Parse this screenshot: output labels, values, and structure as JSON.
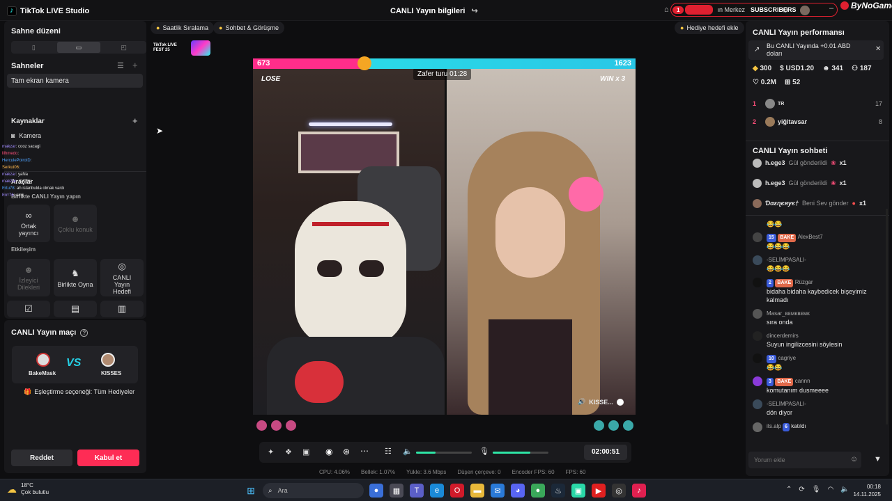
{
  "titlebar": {
    "app_name": "TikTok LIVE Studio",
    "center_title": "CANLI Yayın bilgileri",
    "promo_text": "ın Merkez",
    "subscribers_label": "SUBSCRIBERS",
    "notification_count": "1",
    "brand": "ByNoGame"
  },
  "left": {
    "scene_layout_title": "Sahne düzeni",
    "scenes_title": "Sahneler",
    "scene_item": "Tam ekran kamera",
    "sources_title": "Kaynaklar",
    "camera_label": "Kamera",
    "tools_title": "Araçlar",
    "collab_title": "Birlikte CANLI Yayın yapın",
    "cohost_label": "Ortak yayıncı",
    "multi_guest_label": "Çoklu konuk",
    "interaction_title": "Etkileşim",
    "viewer_wishes_label": "İzleyici Dilekleri",
    "play_together_label": "Birlikte Oyna",
    "live_goal_label": "CANLI Yayın Hedefi",
    "overlay_chat": [
      {
        "user": "makzar",
        "text": ": cooz sacagi",
        "color": "#a28cff"
      },
      {
        "user": "lilhmedo",
        "text": ":",
        "color": "#ff4f7b"
      },
      {
        "user": "HerculePoirotD",
        "text": ":",
        "color": "#4fa3ff"
      },
      {
        "user": "Serkut06",
        "text": ":",
        "color": "#ffb84f"
      },
      {
        "user": "makzar",
        "text": ": yaNa",
        "color": "#a28cff"
      },
      {
        "user": "makZar",
        "text": ": YICEN",
        "color": "#a28cff"
      },
      {
        "user": "Ertu78",
        "text": ": ah istanbulda olmak vardı",
        "color": "#4fa3ff"
      },
      {
        "user": "Errr76",
        "text": ": amk",
        "color": "#a28cff"
      }
    ]
  },
  "match": {
    "title": "CANLI Yayın maçı",
    "host1": "BakeMask",
    "host2": "KISSES",
    "vs": "VS",
    "pairing": "Eşleştirme seçeneği: Tüm Hediyeler",
    "decline": "Reddet",
    "accept": "Kabul et"
  },
  "center": {
    "chip1": "Saatlik Sıralama",
    "chip2": "Sohbet & Görüşme",
    "gift_goal": "Hediye hedefi ekle",
    "fest_label": "TikTok LIVE FEST 25",
    "score_left": "673",
    "score_right": "1623",
    "round": "Zafer turu 01:28",
    "lose": "LOSE",
    "win": "WIN x 3",
    "guest_name": "KISSE...",
    "timer": "02:00:51",
    "stats": {
      "cpu": "CPU: 4.06%",
      "mem": "Bellek: 1.07%",
      "upload": "Yükle: 3.6 Mbps",
      "dropped": "Düşen çerçeve: 0",
      "encoder": "Encoder FPS: 60",
      "fps": "FPS: 60"
    }
  },
  "right": {
    "perf_title": "CANLI Yayın performansı",
    "earn_note": "Bu CANLI Yayında +0.01 ABD doları",
    "metrics": {
      "coins": "300",
      "usd": "USD1.20",
      "viewers": "341",
      "followers": "187",
      "likes": "0.2M",
      "gifts": "52"
    },
    "ranking": [
      {
        "rank": "1",
        "name": "TR",
        "value": "17"
      },
      {
        "rank": "2",
        "name": "yiğitavsar",
        "value": "8"
      }
    ],
    "chat_title": "CANLI Yayın sohbeti",
    "gifts": [
      {
        "user": "h.ege3",
        "text": "Gül gönderildi",
        "count": "x1"
      },
      {
        "user": "h.ege3",
        "text": "Gül gönderildi",
        "count": "x1"
      },
      {
        "user": "Ɗαɛɳєяує†",
        "text": "Beni Sev gönder",
        "count": "x1"
      }
    ],
    "messages": [
      {
        "user": "AlexBest7",
        "level": "15",
        "fan": "BAKE",
        "text": "😂😂😂"
      },
      {
        "user": "-SELİMPASALI-",
        "level": "",
        "fan": "",
        "text": "😂😂😂"
      },
      {
        "user": "Rüzgar",
        "level": "2",
        "fan": "BAKE",
        "text": "bidaha bidaha kaybedicek bişeyimiz kalmadı"
      },
      {
        "user": "Masar_ʙᴇᴍᴋʙᴇᴍᴋ",
        "level": "",
        "fan": "",
        "text": "sıra onda"
      },
      {
        "user": "dincerdemirs",
        "level": "",
        "fan": "",
        "text": "Suyun ingilizcesini söylesin"
      },
      {
        "user": "cagriye",
        "level": "10",
        "fan": "",
        "text": "😂😂"
      },
      {
        "user": "cannn",
        "level": "3",
        "fan": "BAKE",
        "text": "komutanım dusmeeee"
      },
      {
        "user": "-SELİMPASALI-",
        "level": "",
        "fan": "",
        "text": "dön diyor"
      }
    ],
    "join": {
      "user": "its.alp",
      "level": "6",
      "text": "katıldı"
    },
    "comment_placeholder": "Yorum ekle"
  },
  "taskbar": {
    "weather_temp": "18°C",
    "weather_desc": "Çok bulutlu",
    "search": "Ara",
    "time": "00:18",
    "date": "14.11.2025"
  }
}
